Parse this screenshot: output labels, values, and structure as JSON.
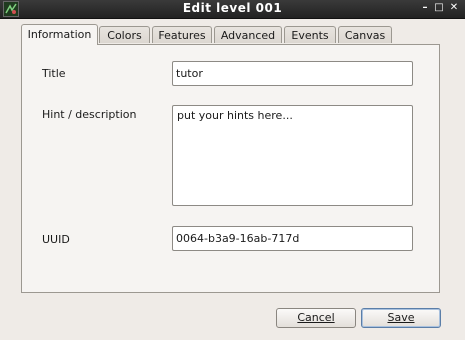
{
  "window": {
    "title": "Edit level 001",
    "controls": {
      "minimize": "–",
      "maximize": "□",
      "close": "✕"
    }
  },
  "tabs": [
    {
      "label": "Information",
      "active": true
    },
    {
      "label": "Colors",
      "active": false
    },
    {
      "label": "Features",
      "active": false
    },
    {
      "label": "Advanced",
      "active": false
    },
    {
      "label": "Events",
      "active": false
    },
    {
      "label": "Canvas",
      "active": false
    }
  ],
  "form": {
    "title_label": "Title",
    "title_value": "tutor",
    "hint_label": "Hint / description",
    "hint_value": "put your hints here...",
    "uuid_label": "UUID",
    "uuid_value": "0064-b3a9-16ab-717d"
  },
  "buttons": {
    "cancel_label": "Cancel",
    "save_label": "Save"
  },
  "colors": {
    "titlebar": "#2a2a2a",
    "window_bg": "#efebe7",
    "panel_bg": "#f6f4f2",
    "default_button_border": "#5b7ea8"
  }
}
